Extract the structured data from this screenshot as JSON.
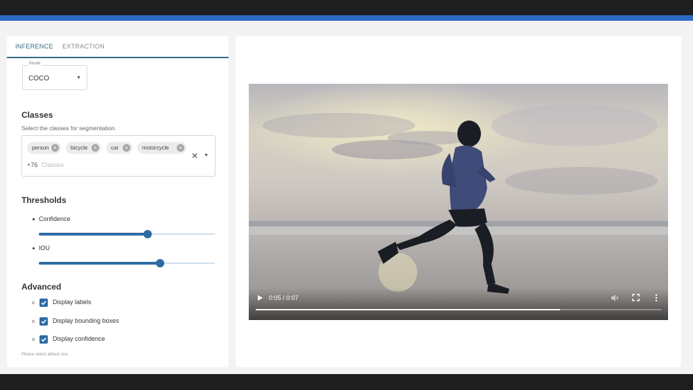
{
  "tabs": [
    {
      "label": "INFERENCE",
      "active": true
    },
    {
      "label": "EXTRACTION",
      "active": false
    }
  ],
  "model": {
    "legend": "Model",
    "value": "COCO"
  },
  "classes": {
    "title": "Classes",
    "subtitle": "Select the classes for segmentation.",
    "chips": [
      "person",
      "bicycle",
      "car",
      "motorcycle"
    ],
    "more_count": "+76",
    "placeholder": "Classes"
  },
  "thresholds": {
    "title": "Thresholds",
    "sliders": [
      {
        "label": "Confidence",
        "value": 0.62
      },
      {
        "label": "IOU",
        "value": 0.69
      }
    ]
  },
  "advanced": {
    "title": "Advanced",
    "options": [
      {
        "label": "Display labels",
        "checked": true
      },
      {
        "label": "Display bounding boxes",
        "checked": true
      },
      {
        "label": "Display confidence",
        "checked": true
      }
    ],
    "helper": "Please select atleast one."
  },
  "video": {
    "time": "0:05 / 0:07",
    "progress": 0.75
  },
  "colors": {
    "accent": "#2d6ba3",
    "top_bar": "#2f6ac5",
    "tab_active": "#2f6a86"
  },
  "icons": [
    "clear-icon",
    "dropdown-caret-icon",
    "play-icon",
    "volume-mute-icon",
    "fullscreen-icon",
    "more-options-icon",
    "checkbox-check-icon"
  ]
}
